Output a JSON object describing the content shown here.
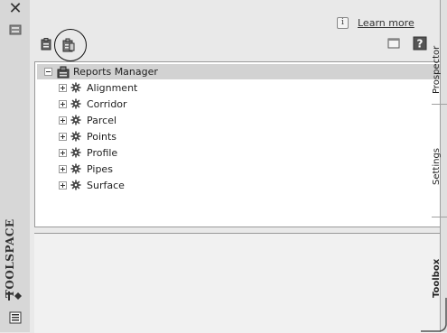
{
  "window": {
    "close_symbol": "✕",
    "title": "TOOLSPACE"
  },
  "header": {
    "learn_more": "Learn more",
    "info_symbol": "i"
  },
  "tree": {
    "root": {
      "label": "Reports Manager",
      "expanded": true,
      "icon": "reports-manager-icon"
    },
    "items": [
      {
        "label": "Alignment",
        "icon": "gear-icon"
      },
      {
        "label": "Corridor",
        "icon": "gear-icon"
      },
      {
        "label": "Parcel",
        "icon": "gear-icon"
      },
      {
        "label": "Points",
        "icon": "gear-icon"
      },
      {
        "label": "Profile",
        "icon": "gear-icon"
      },
      {
        "label": "Pipes",
        "icon": "gear-icon"
      },
      {
        "label": "Surface",
        "icon": "gear-icon"
      }
    ]
  },
  "side_tabs": [
    {
      "label": "Prospector",
      "active": false
    },
    {
      "label": "Settings",
      "active": false
    },
    {
      "label": "Toolbox",
      "active": true
    }
  ],
  "colors": {
    "background": "#e9e9e9",
    "tree_background": "#ffffff",
    "selection": "#d2d2d2"
  }
}
